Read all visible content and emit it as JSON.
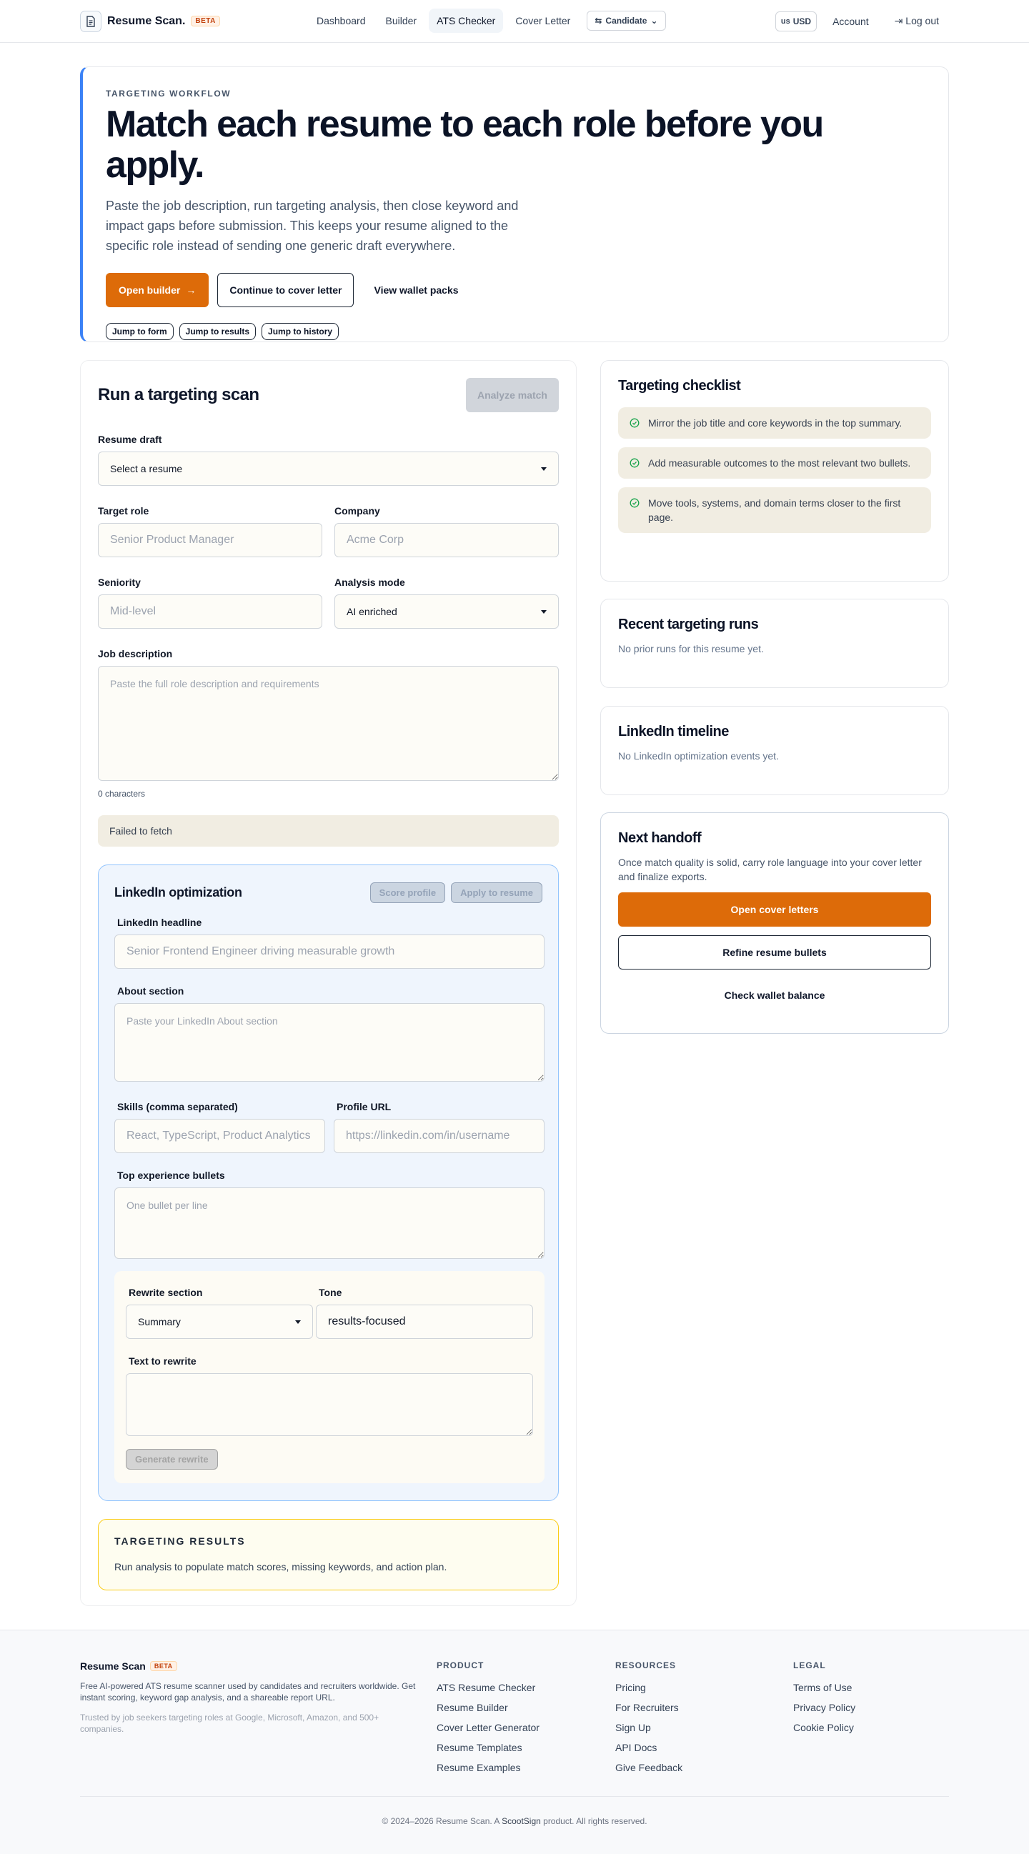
{
  "nav": {
    "brand": "Resume Scan.",
    "beta": "BETA",
    "links": [
      "Dashboard",
      "Builder",
      "ATS Checker",
      "Cover Letter"
    ],
    "role": "Candidate",
    "currency_code": "us",
    "currency": "USD",
    "account": "Account",
    "logout": "Log out"
  },
  "hero": {
    "eyebrow": "TARGETING WORKFLOW",
    "title": "Match each resume to each role before you apply.",
    "body": "Paste the job description, run targeting analysis, then close keyword and impact gaps before submission. This keeps your resume aligned to the specific role instead of sending one generic draft everywhere.",
    "primary": "Open builder",
    "secondary": "Continue to cover letter",
    "tertiary": "View wallet packs",
    "jumps": [
      "Jump to form",
      "Jump to results",
      "Jump to history"
    ]
  },
  "scan": {
    "title": "Run a targeting scan",
    "analyze": "Analyze match",
    "resume_label": "Resume draft",
    "resume_value": "Select a resume",
    "role_label": "Target role",
    "role_placeholder": "Senior Product Manager",
    "company_label": "Company",
    "company_placeholder": "Acme Corp",
    "seniority_label": "Seniority",
    "seniority_placeholder": "Mid-level",
    "mode_label": "Analysis mode",
    "mode_value": "AI enriched",
    "jd_label": "Job description",
    "jd_placeholder": "Paste the full role description and requirements",
    "chars": "0 characters",
    "error": "Failed to fetch"
  },
  "linkedin": {
    "title": "LinkedIn optimization",
    "score": "Score profile",
    "apply": "Apply to resume",
    "headline_label": "LinkedIn headline",
    "headline_placeholder": "Senior Frontend Engineer driving measurable growth",
    "about_label": "About section",
    "about_placeholder": "Paste your LinkedIn About section",
    "skills_label": "Skills (comma separated)",
    "skills_placeholder": "React, TypeScript, Product Analytics",
    "url_label": "Profile URL",
    "url_placeholder": "https://linkedin.com/in/username",
    "bullets_label": "Top experience bullets",
    "bullets_placeholder": "One bullet per line",
    "rewrite_label": "Rewrite section",
    "rewrite_value": "Summary",
    "tone_label": "Tone",
    "tone_value": "results-focused",
    "text_label": "Text to rewrite",
    "generate": "Generate rewrite"
  },
  "results": {
    "title": "TARGETING RESULTS",
    "text": "Run analysis to populate match scores, missing keywords, and action plan."
  },
  "checklist": {
    "title": "Targeting checklist",
    "items": [
      "Mirror the job title and core keywords in the top summary.",
      "Add measurable outcomes to the most relevant two bullets.",
      "Move tools, systems, and domain terms closer to the first page."
    ]
  },
  "recent": {
    "title": "Recent targeting runs",
    "text": "No prior runs for this resume yet."
  },
  "timeline": {
    "title": "LinkedIn timeline",
    "text": "No LinkedIn optimization events yet."
  },
  "handoff": {
    "title": "Next handoff",
    "text": "Once match quality is solid, carry role language into your cover letter and finalize exports.",
    "primary": "Open cover letters",
    "secondary": "Refine resume bullets",
    "tertiary": "Check wallet balance"
  },
  "footer": {
    "brand": "Resume Scan",
    "beta": "BETA",
    "desc": "Free AI-powered ATS resume scanner used by candidates and recruiters worldwide. Get instant scoring, keyword gap analysis, and a shareable report URL.",
    "trust": "Trusted by job seekers targeting roles at Google, Microsoft, Amazon, and 500+ companies.",
    "product_title": "PRODUCT",
    "product": [
      "ATS Resume Checker",
      "Resume Builder",
      "Cover Letter Generator",
      "Resume Templates",
      "Resume Examples"
    ],
    "resources_title": "RESOURCES",
    "resources": [
      "Pricing",
      "For Recruiters",
      "Sign Up",
      "API Docs",
      "Give Feedback"
    ],
    "legal_title": "LEGAL",
    "legal": [
      "Terms of Use",
      "Privacy Policy",
      "Cookie Policy"
    ],
    "copy_pre": "© 2024–2026 Resume Scan. A",
    "copy_brand": "ScootSign",
    "copy_post": "product. All rights reserved."
  },
  "colors": {
    "accent": "#dd6b09",
    "hero_border": "#3b82f6",
    "linkedin_bg": "#eff5fd",
    "results_border": "#facc15"
  }
}
